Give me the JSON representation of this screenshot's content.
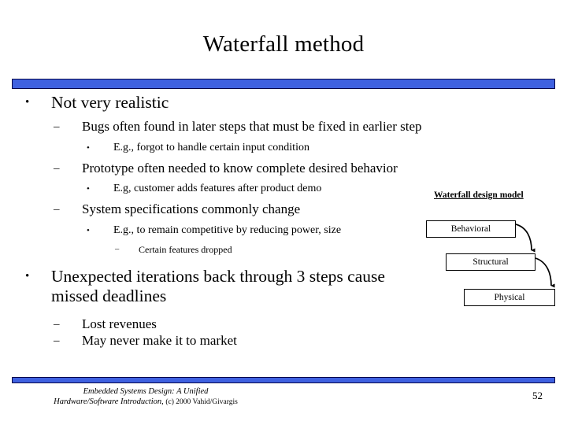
{
  "slide": {
    "title": "Waterfall method",
    "number": "52",
    "accent_color": "#3F61E0",
    "accent_border_color": "#06064A",
    "background_color": "#FFFFFF",
    "text_color": "#000000"
  },
  "outline": [
    {
      "level": 1,
      "marker": "•",
      "text": "Not very realistic"
    },
    {
      "level": 2,
      "marker": "–",
      "text": "Bugs often found in later steps that must be fixed in earlier step"
    },
    {
      "level": 3,
      "marker": "•",
      "text": "E.g., forgot to handle certain input condition"
    },
    {
      "level": 2,
      "marker": "–",
      "text": "Prototype often needed to know complete desired behavior"
    },
    {
      "level": 3,
      "marker": "•",
      "text": "E.g, customer adds features after product demo"
    },
    {
      "level": 2,
      "marker": "–",
      "text": "System specifications commonly change"
    },
    {
      "level": 3,
      "marker": "•",
      "text": "E.g., to remain competitive by reducing power, size"
    },
    {
      "level": 4,
      "marker": "–",
      "text": "Certain features dropped"
    },
    {
      "level": 1,
      "marker": "•",
      "text": "Unexpected iterations back through 3 steps cause missed deadlines"
    },
    {
      "level": 2,
      "marker": "–",
      "text": "Lost revenues"
    },
    {
      "level": 2,
      "marker": "–",
      "text": "May never make it to market"
    }
  ],
  "diagram": {
    "title": "Waterfall design model",
    "boxes": [
      {
        "label": "Behavioral"
      },
      {
        "label": "Structural"
      },
      {
        "label": "Physical"
      }
    ],
    "arrow_count": 2,
    "arrow_direction": "downward-curved"
  },
  "footer": {
    "credit_line1": "Embedded Systems Design: A Unified",
    "credit_line2_italic": "Hardware/Software Introduction,",
    "credit_line2_plain": "(c) 2000 Vahid/Givargis"
  }
}
